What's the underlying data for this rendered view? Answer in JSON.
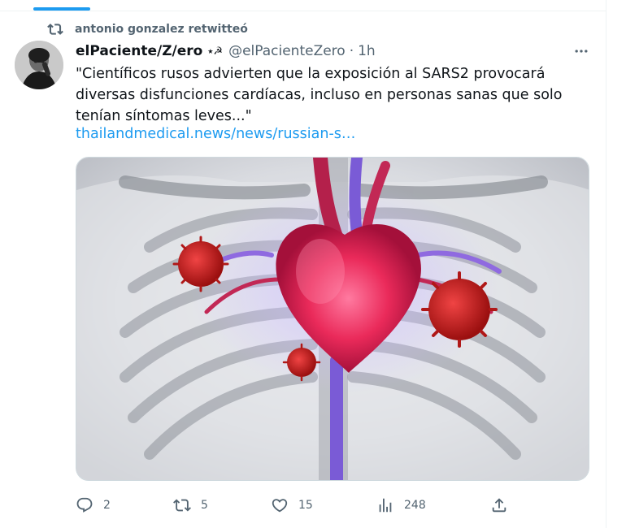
{
  "retweet": {
    "label": "antonio gonzalez retwitteó"
  },
  "author": {
    "display_name": "elPaciente/Z/ero",
    "emoji_badge": "⭑☭",
    "handle": "@elPacienteZero",
    "separator": "·",
    "time": "1h"
  },
  "tweet": {
    "text": "\"Científicos rusos advierten que la exposición al SARS2 provocará diversas disfunciones cardíacas, incluso en personas sanas que solo tenían síntomas leves...\"",
    "link": "thailandmedical.news/news/russian-s…"
  },
  "media": {
    "description": "heart-xray-illustration"
  },
  "actions": {
    "replies": "2",
    "retweets": "5",
    "likes": "15",
    "views": "248"
  },
  "colors": {
    "accent": "#1d9bf0",
    "secondary_text": "#536471",
    "primary_text": "#0f1419"
  },
  "icons": [
    "retweet-icon",
    "more-icon",
    "reply-icon",
    "retweet-icon",
    "like-icon",
    "views-icon",
    "share-icon"
  ]
}
